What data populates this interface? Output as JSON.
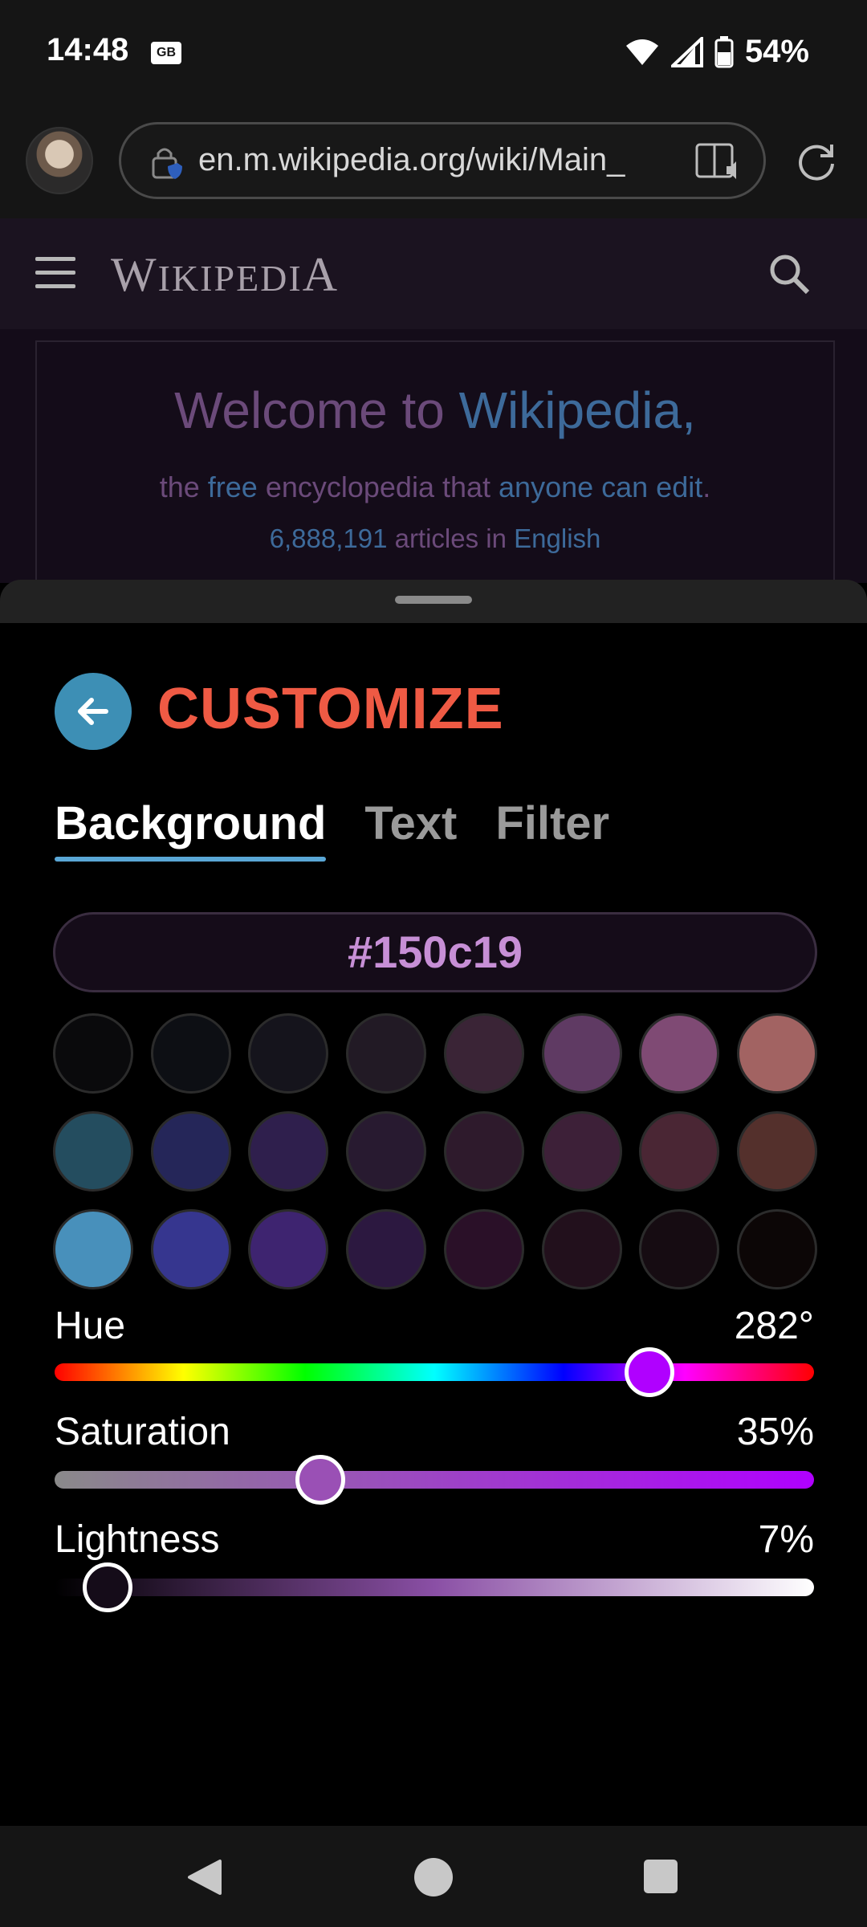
{
  "status_bar": {
    "time": "14:48",
    "gb_badge": "GB",
    "battery": "54%"
  },
  "browser": {
    "url": "en.m.wikipedia.org/wiki/Main_"
  },
  "wiki": {
    "logo_w": "W",
    "logo_rest": "IKIPEDI",
    "logo_a": "A",
    "welcome_prefix": "Welcome to ",
    "welcome_link": "Wikipedia",
    "welcome_suffix": ",",
    "subtitle_prefix": "the ",
    "subtitle_link": "free",
    "subtitle_middle": " encyclopedia that ",
    "subtitle_link2": "anyone can edit",
    "subtitle_suffix": ".",
    "article_count": "6,888,191",
    "article_suffix_1": " articles in ",
    "article_language": "English"
  },
  "sheet": {
    "title": "CUSTOMIZE",
    "tabs": [
      {
        "label": "Background",
        "active": true
      },
      {
        "label": "Text",
        "active": false
      },
      {
        "label": "Filter",
        "active": false
      }
    ],
    "hex_value": "#150c19",
    "swatches": [
      [
        "#0a0a0c",
        "#0d0f14",
        "#15141c",
        "#221a25",
        "#3a2436",
        "#5f3a63",
        "#7f4a74",
        "#a26362"
      ],
      [
        "#244d5f",
        "#252659",
        "#2f1f4d",
        "#281a30",
        "#2e1a2c",
        "#3d2038",
        "#4a2634",
        "#54302c"
      ],
      [
        "#4890bb",
        "#36368f",
        "#3e2470",
        "#2c1840",
        "#2a1028",
        "#22101c",
        "#160c12",
        "#0c0606"
      ]
    ],
    "sliders": {
      "hue": {
        "label": "Hue",
        "value_text": "282°",
        "value": 282,
        "max": 360,
        "thumb_color": "#b000ff"
      },
      "saturation": {
        "label": "Saturation",
        "value_text": "35%",
        "value": 35,
        "max": 100,
        "thumb_color": "#9a50b5"
      },
      "lightness": {
        "label": "Lightness",
        "value_text": "7%",
        "value": 7,
        "max": 100,
        "thumb_color": "#150c19"
      }
    }
  },
  "colors": {
    "accent_title": "#ef5a44",
    "tab_underline": "#5aa7d6",
    "back_button": "#3d8fb5"
  }
}
